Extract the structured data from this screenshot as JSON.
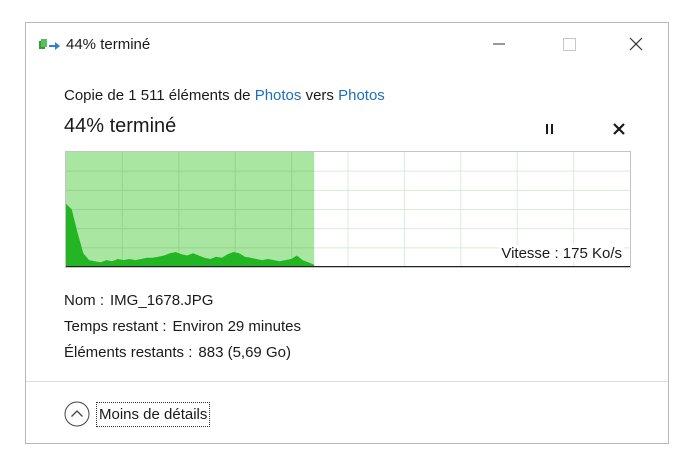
{
  "window": {
    "title": "44% terminé"
  },
  "copy": {
    "prefix": "Copie de 1 511 éléments de",
    "source": "Photos",
    "middle": "vers",
    "destination": "Photos"
  },
  "progress": {
    "status": "44% terminé",
    "percent": 44,
    "speed_label": "Vitesse : 175 Ko/s",
    "speed_history": [
      0.55,
      0.5,
      0.3,
      0.12,
      0.06,
      0.05,
      0.04,
      0.06,
      0.05,
      0.07,
      0.06,
      0.07,
      0.06,
      0.07,
      0.08,
      0.08,
      0.09,
      0.1,
      0.12,
      0.13,
      0.11,
      0.1,
      0.12,
      0.1,
      0.08,
      0.07,
      0.09,
      0.08,
      0.11,
      0.13,
      0.12,
      0.09,
      0.08,
      0.07,
      0.06,
      0.07,
      0.06,
      0.05,
      0.06,
      0.07,
      0.1,
      0.06,
      0.04,
      0.02
    ]
  },
  "details": {
    "name_label": "Nom :",
    "name_value": "IMG_1678.JPG",
    "time_label": "Temps restant :",
    "time_value": "Environ 29 minutes",
    "items_label": "Éléments restants :",
    "items_value": "883 (5,69 Go)"
  },
  "footer": {
    "less_details_label": "Moins de détails"
  },
  "colors": {
    "progress_fill": "#a8e6a1",
    "speed_fill": "#23b523",
    "grid_line": "#c8e6c8",
    "link": "#1e6fb8"
  }
}
